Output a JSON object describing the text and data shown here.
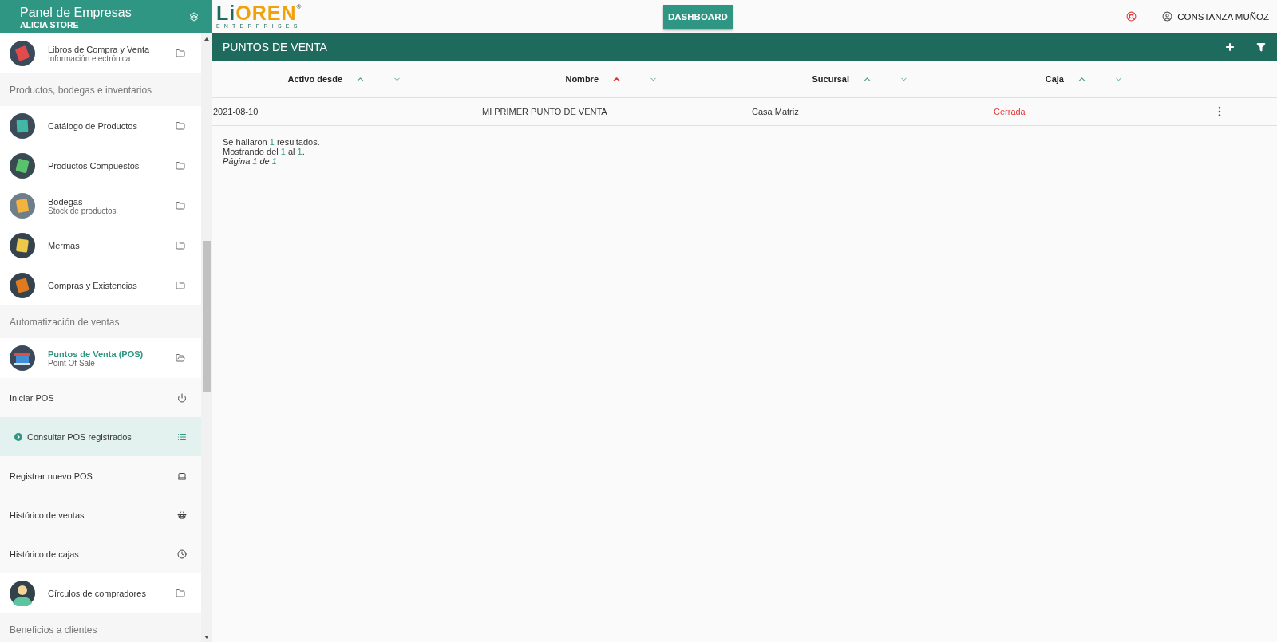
{
  "sidebar": {
    "title": "Panel de Empresas",
    "subtitle": "ALICIA STORE",
    "items": [
      {
        "kind": "module",
        "title": "Libros de Compra y Venta",
        "subtitle": "Información electrónica",
        "expanded": false
      },
      {
        "kind": "section",
        "title": "Productos, bodegas e inventarios"
      },
      {
        "kind": "module",
        "title": "Catálogo de Productos",
        "expanded": false
      },
      {
        "kind": "module",
        "title": "Productos Compuestos",
        "expanded": false
      },
      {
        "kind": "module",
        "title": "Bodegas",
        "subtitle": "Stock de productos",
        "expanded": false
      },
      {
        "kind": "module",
        "title": "Mermas",
        "expanded": false
      },
      {
        "kind": "module",
        "title": "Compras y Existencias",
        "expanded": false
      },
      {
        "kind": "section",
        "title": "Automatización de ventas"
      },
      {
        "kind": "module",
        "title": "Puntos de Venta (POS)",
        "subtitle": "Point Of Sale",
        "expanded": true
      },
      {
        "kind": "action",
        "title": "Iniciar POS",
        "selected": false
      },
      {
        "kind": "action",
        "title": "Consultar POS registrados",
        "selected": true
      },
      {
        "kind": "action",
        "title": "Registrar nuevo POS",
        "selected": false
      },
      {
        "kind": "action",
        "title": "Histórico de ventas",
        "selected": false
      },
      {
        "kind": "action",
        "title": "Histórico de cajas",
        "selected": false
      },
      {
        "kind": "module",
        "title": "Círculos de compradores",
        "expanded": false
      },
      {
        "kind": "section",
        "title": "Beneficios a clientes"
      }
    ]
  },
  "topbar": {
    "logo": {
      "wordmark": [
        "Li",
        "OREN"
      ],
      "registered": "®",
      "tagline": "ENTERPRISES"
    },
    "dashboard_button": "DASHBOARD",
    "user": "CONSTANZA MUÑOZ"
  },
  "panel": {
    "title": "PUNTOS DE VENTA",
    "table": {
      "columns": [
        {
          "label": "Activo desde",
          "sort_active": false
        },
        {
          "label": "Nombre",
          "sort_active": true
        },
        {
          "label": "Sucursal",
          "sort_active": false
        },
        {
          "label": "Caja",
          "sort_active": false
        }
      ],
      "rows": [
        {
          "activo_desde": "2021-08-10",
          "nombre": "MI PRIMER PUNTO DE VENTA",
          "sucursal": "Casa Matriz",
          "caja": {
            "text": "Cerrada",
            "open": false
          }
        }
      ]
    },
    "summary": [
      [
        {
          "text": "Se hallaron "
        },
        {
          "text": "1",
          "highlight": true
        },
        {
          "text": " resultados."
        }
      ],
      [
        {
          "text": "Mostrando del "
        },
        {
          "text": "1",
          "highlight": true
        },
        {
          "text": " al "
        },
        {
          "text": "1",
          "highlight": true
        },
        {
          "text": "."
        }
      ],
      [
        {
          "text": "Página "
        },
        {
          "text": "1",
          "highlight": true
        },
        {
          "text": " de "
        },
        {
          "text": "1",
          "highlight": true
        }
      ]
    ]
  }
}
